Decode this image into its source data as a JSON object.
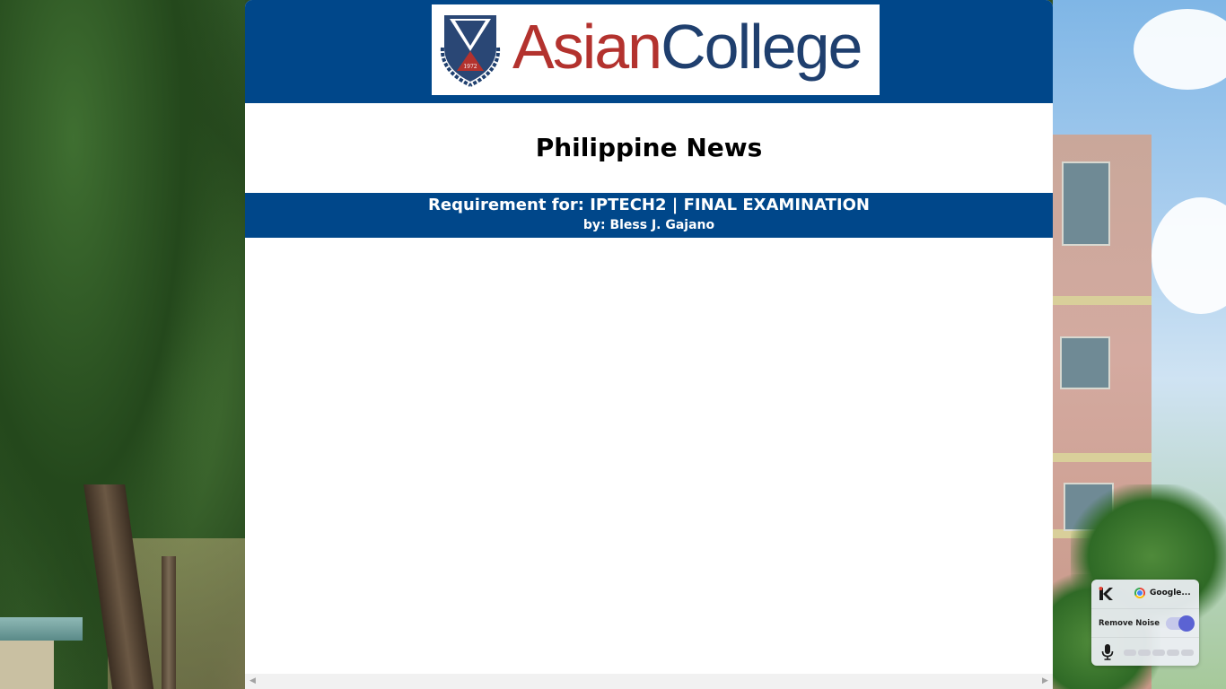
{
  "header": {
    "logo": {
      "word1": "Asian",
      "word2": "College",
      "crest_year": "1972",
      "colors": {
        "red": "#b3322e",
        "navy": "#1f3f6e"
      }
    },
    "background_color": "#00478a"
  },
  "main": {
    "title": "Philippine News",
    "requirement": "Requirement for: IPTECH2 | FINAL EXAMINATION",
    "author": "by: Bless J. Gajano"
  },
  "scrollbar": {
    "left_arrow": "◀",
    "right_arrow": "▶"
  },
  "widget": {
    "app_icon": "krisp-k-icon",
    "source": "Google...",
    "source_icon": "chrome-icon",
    "remove_noise_label": "Remove Noise",
    "remove_noise_enabled": true,
    "mic_icon": "microphone-icon",
    "accent_color": "#5b63d3"
  }
}
